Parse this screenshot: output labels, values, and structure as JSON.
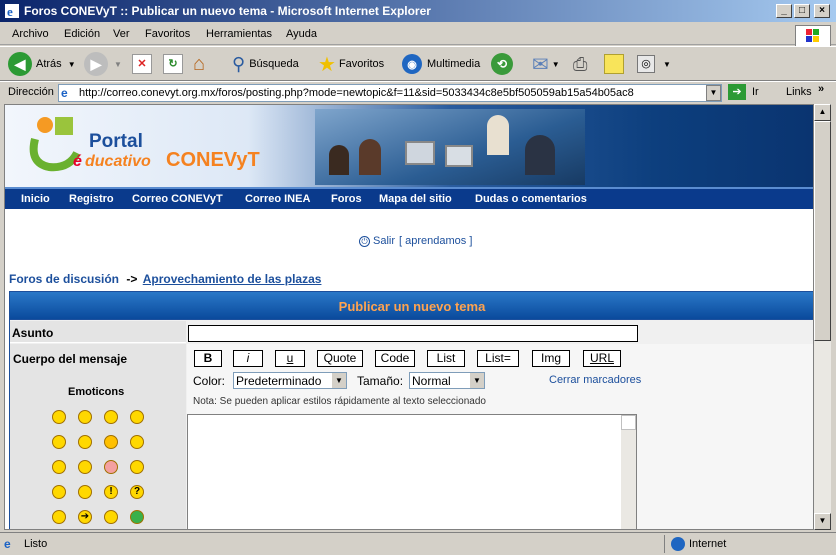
{
  "window": {
    "title": "Foros CONEVyT :: Publicar un nuevo tema - Microsoft Internet Explorer"
  },
  "menu": [
    "Archivo",
    "Edición",
    "Ver",
    "Favoritos",
    "Herramientas",
    "Ayuda"
  ],
  "toolbar": {
    "back": "Atrás",
    "search": "Búsqueda",
    "favorites": "Favoritos",
    "media": "Multimedia"
  },
  "address": {
    "label": "Dirección",
    "url": "http://correo.conevyt.org.mx/foros/posting.php?mode=newtopic&f=11&sid=5033434c8e5bf505059ab15a54b05ac8",
    "go": "Ir",
    "links": "Links"
  },
  "banner": {
    "portal": "Portal",
    "educativo": "ducativo",
    "brand": "CONEVyT"
  },
  "nav": [
    "Inicio",
    "Registro",
    "Correo CONEVyT",
    "Correo INEA",
    "Foros",
    "Mapa del sitio",
    "Dudas o comentarios"
  ],
  "logout": {
    "salir": "Salir",
    "user": "[ aprendamos ]"
  },
  "breadcrumb": {
    "root": "Foros de discusión",
    "sep": "->",
    "forum": "Aprovechamiento de las plazas"
  },
  "form": {
    "header": "Publicar un nuevo tema",
    "subject_label": "Asunto",
    "body_label": "Cuerpo del mensaje",
    "emoticons_label": "Emoticons",
    "color_label": "Color:",
    "color_value": "Predeterminado",
    "size_label": "Tamaño:",
    "size_value": "Normal",
    "close_tags": "Cerrar marcadores",
    "note": "Nota: Se pueden aplicar estilos rápidamente al texto seleccionado"
  },
  "format_buttons": {
    "b": "B",
    "i": "i",
    "u": "u",
    "quote": "Quote",
    "code": "Code",
    "list": "List",
    "listeq": "List=",
    "img": "Img",
    "url": "URL"
  },
  "status": {
    "left": "Listo",
    "zone": "Internet"
  }
}
